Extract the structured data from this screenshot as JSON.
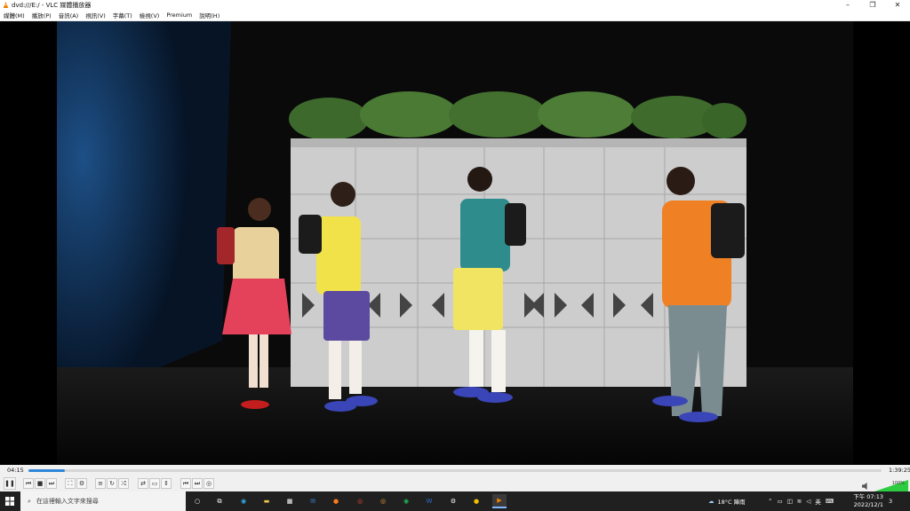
{
  "window": {
    "title": "dvd:///E:/ - VLC 媒體播放器",
    "minimize": "–",
    "maximize": "❐",
    "close": "✕"
  },
  "menu": [
    "媒體(M)",
    "播放(P)",
    "音訊(A)",
    "視訊(V)",
    "字幕(T)",
    "檢視(V)",
    "Premium",
    "說明(H)"
  ],
  "player": {
    "elapsed": "04:15",
    "total": "1:39:25",
    "progress": 0.043,
    "volume_label": "100%"
  },
  "controls": {
    "play_pause": "❚❚",
    "prev": "⏮",
    "stop": "■",
    "next": "⏭",
    "fullscreen": "⛶",
    "extended": "⚙",
    "playlist": "≡",
    "loop": "↻",
    "random": "⤮",
    "ab_loop": "⇄",
    "snapshot": "▭",
    "frame": "⇕",
    "prev_chapter": "⏮",
    "next_chapter": "⏭",
    "disc_menu": "◎"
  },
  "taskbar": {
    "search_placeholder": "在這裡輸入文字來搜尋",
    "weather": "18°C  陣雨",
    "ime": "英",
    "time": "下午 07:13",
    "date": "2022/12/1",
    "notify": "3"
  },
  "colors": {
    "accent": "#2f86d8",
    "taskbar": "#202020"
  }
}
